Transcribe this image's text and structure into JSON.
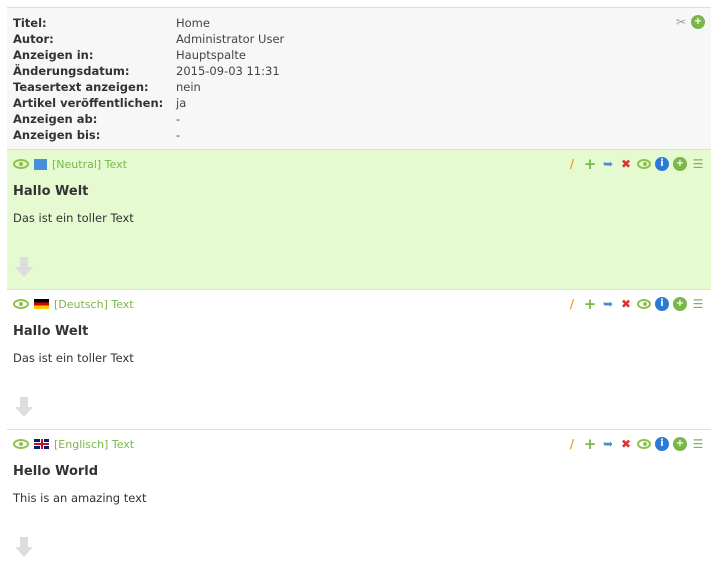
{
  "meta": {
    "rows": [
      {
        "label": "Titel:",
        "value": "Home"
      },
      {
        "label": "Autor:",
        "value": "Administrator User"
      },
      {
        "label": "Anzeigen in:",
        "value": "Hauptspalte"
      },
      {
        "label": "Änderungsdatum:",
        "value": "2015-09-03 11:31"
      },
      {
        "label": "Teasertext anzeigen:",
        "value": "nein"
      },
      {
        "label": "Artikel veröffentlichen:",
        "value": "ja"
      },
      {
        "label": "Anzeigen ab:",
        "value": "-"
      },
      {
        "label": "Anzeigen bis:",
        "value": "-"
      }
    ],
    "tools": [
      "tools-icon",
      "add-circle-icon"
    ]
  },
  "blocks": [
    {
      "lang": "[Neutral] Text",
      "flag": "neutral",
      "title": "Hallo Welt",
      "text": "Das ist ein toller Text",
      "active": true
    },
    {
      "lang": "[Deutsch] Text",
      "flag": "de",
      "title": "Hallo Welt",
      "text": "Das ist ein toller Text",
      "active": false
    },
    {
      "lang": "[Englisch] Text",
      "flag": "gb",
      "title": "Hello World",
      "text": "This is an amazing text",
      "active": false
    }
  ],
  "block_tools": [
    "edit-pencil-icon",
    "add-icon",
    "move-icon",
    "delete-icon",
    "visibility-eye-icon",
    "info-icon",
    "add-circle-icon",
    "menu-icon"
  ],
  "colors": {
    "active_bg": "#e6fad2",
    "accent": "#7ab648"
  }
}
